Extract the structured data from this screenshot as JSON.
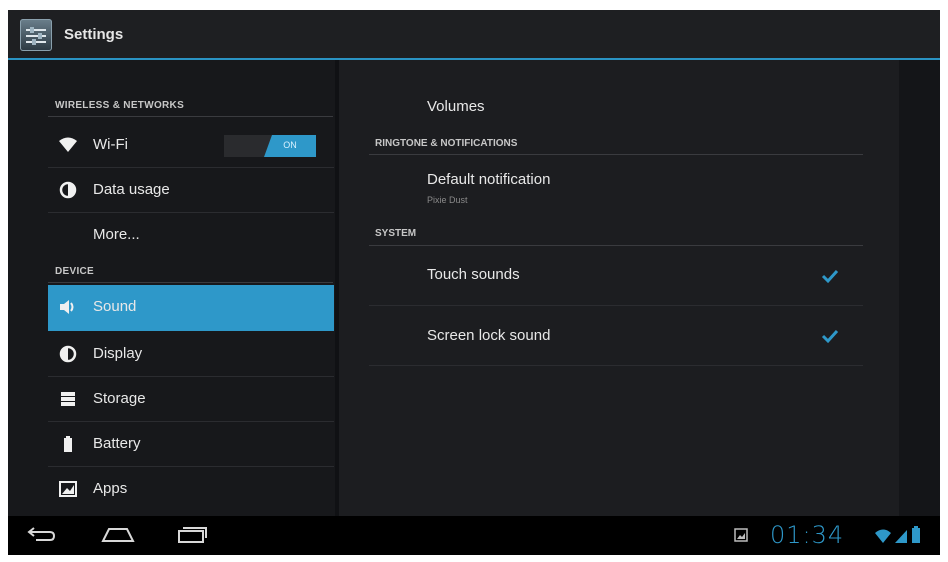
{
  "app": {
    "title": "Settings"
  },
  "sidebar": {
    "sections": {
      "wireless": "WIRELESS & NETWORKS",
      "device": "DEVICE"
    },
    "items": {
      "wifi": {
        "label": "Wi-Fi",
        "icon": "wifi-icon",
        "toggle_label": "ON"
      },
      "data_usage": {
        "label": "Data usage",
        "icon": "data-usage-icon"
      },
      "more": {
        "label": "More..."
      },
      "sound": {
        "label": "Sound",
        "icon": "speaker-icon",
        "selected": true
      },
      "display": {
        "label": "Display",
        "icon": "display-icon"
      },
      "storage": {
        "label": "Storage",
        "icon": "storage-icon"
      },
      "battery": {
        "label": "Battery",
        "icon": "battery-icon"
      },
      "apps": {
        "label": "Apps",
        "icon": "apps-icon"
      }
    }
  },
  "content": {
    "volumes": {
      "label": "Volumes"
    },
    "ringtone_header": "RINGTONE & NOTIFICATIONS",
    "default_notification": {
      "label": "Default notification",
      "summary": "Pixie Dust"
    },
    "system_header": "SYSTEM",
    "touch_sounds": {
      "label": "Touch sounds",
      "checked": true
    },
    "screen_lock_sound": {
      "label": "Screen lock sound",
      "checked": true
    }
  },
  "navbar": {
    "clock": "01:34",
    "buttons": [
      "back-icon",
      "home-icon",
      "recent-apps-icon"
    ],
    "status_icons": [
      "gallery-notification-icon",
      "wifi-signal-icon",
      "cell-signal-icon",
      "battery-status-icon"
    ]
  },
  "colors": {
    "accent": "#2e98c9",
    "background": "#101114",
    "pane": "#1c1d20"
  }
}
